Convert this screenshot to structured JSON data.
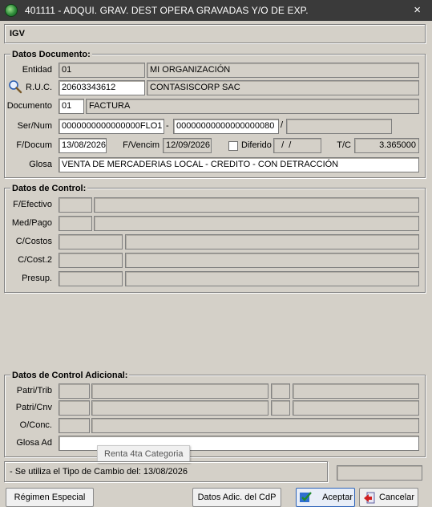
{
  "window": {
    "title": "401111 - ADQUI. GRAV. DEST OPERA GRAVADAS Y/O DE EXP.",
    "close": "×"
  },
  "header_box": {
    "label": "IGV"
  },
  "datos_documento": {
    "legend": "Datos Documento:",
    "entidad_label": "Entidad",
    "entidad_code": "01",
    "entidad_name": "MI ORGANIZACIÓN",
    "ruc_label": "R.U.C.",
    "ruc_value": "20603343612",
    "ruc_name": "CONTASISCORP SAC",
    "documento_label": "Documento",
    "documento_code": "01",
    "documento_name": "FACTURA",
    "sernum_label": "Ser/Num",
    "serie": "0000000000000000FLO1",
    "dash": "-",
    "numero": "00000000000000000080",
    "slash": "/",
    "extra": "",
    "fdocum_label": "F/Docum",
    "fdocum": "13/08/2026",
    "fvencim_label": "F/Vencim",
    "fvencim": "12/09/2026",
    "diferido_label": "Diferido",
    "diferido_date": "  /  /",
    "tc_label": "T/C",
    "tc_value": "3.365000",
    "glosa_label": "Glosa",
    "glosa": "VENTA DE MERCADERIAS LOCAL - CREDITO - CON DETRACCIÓN"
  },
  "datos_control": {
    "legend": "Datos de Control:",
    "fefectivo_label": "F/Efectivo",
    "medpago_label": "Med/Pago",
    "ccostos_label": "C/Costos",
    "ccost2_label": "C/Cost.2",
    "presup_label": "Presup."
  },
  "datos_control_adicional": {
    "legend": "Datos de Control Adicional:",
    "patritrib_label": "Patri/Trib",
    "patricnv_label": "Patri/Cnv",
    "oconc_label": "O/Conc.",
    "glosa_ad_label": "Glosa Ad"
  },
  "tooltip": "Renta 4ta Categoria",
  "status": {
    "message": "- Se utiliza el Tipo de Cambio del: 13/08/2026"
  },
  "buttons": {
    "regimen": "Régimen Especial",
    "datos_adic": "Datos Adic. del CdP",
    "aceptar": "Aceptar",
    "cancelar": "Cancelar"
  }
}
